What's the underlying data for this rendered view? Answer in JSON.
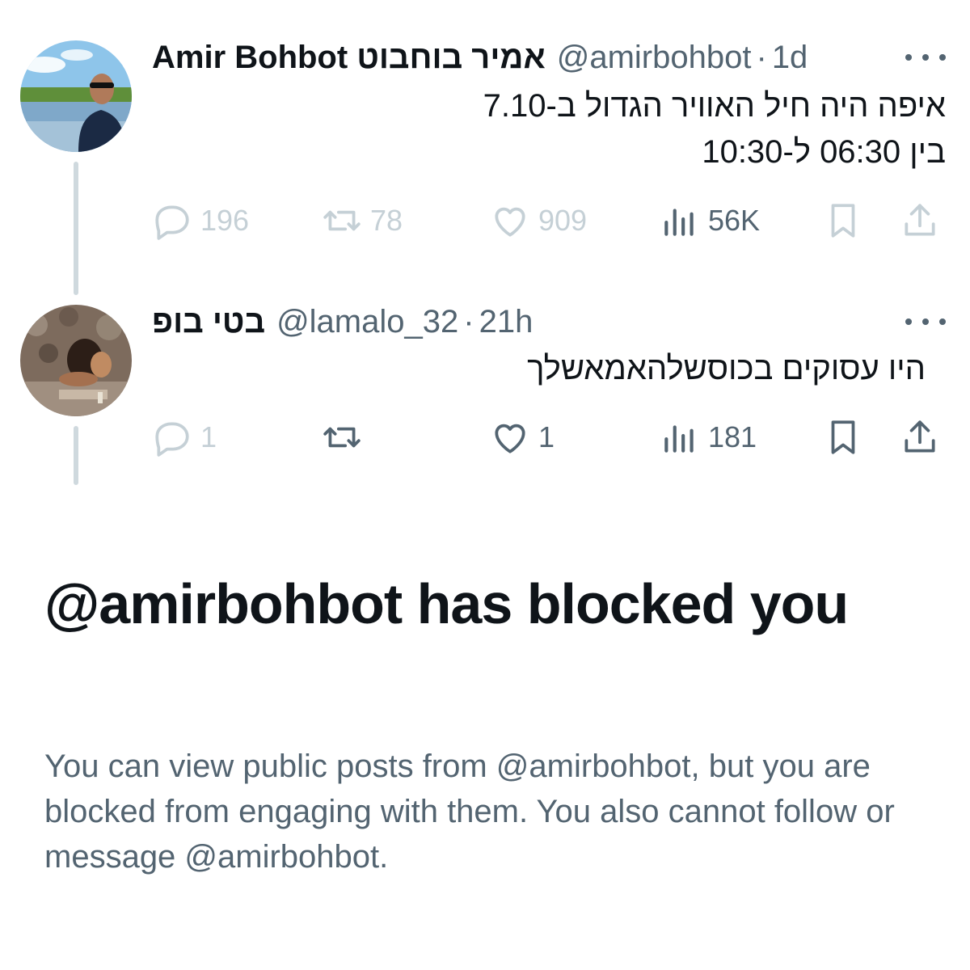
{
  "tweets": [
    {
      "name": "Amir Bohbot אמיר בוחבוט",
      "handle": "@amirbohbot",
      "time": "1d",
      "text_lines": [
        "איפה היה חיל האוויר הגדול ב-7.10",
        "בין 06:30 ל-10:30"
      ],
      "stats": {
        "replies": "196",
        "reposts": "78",
        "likes": "909",
        "views": "56K"
      },
      "icons": [
        "reply-icon",
        "repost-icon",
        "like-icon",
        "views-icon",
        "bookmark-icon",
        "share-icon"
      ]
    },
    {
      "name": "בטי בופ",
      "handle": "@lamalo_32",
      "time": "21h",
      "text": "היו עסוקים בכוסשלהאמאשלך",
      "stats": {
        "replies": "1",
        "reposts": "",
        "likes": "1",
        "views": "181"
      },
      "icons": [
        "reply-icon",
        "repost-icon",
        "like-icon",
        "views-icon",
        "bookmark-icon",
        "share-icon"
      ]
    }
  ],
  "blocked": {
    "title": "@amirbohbot has blocked you",
    "description": "You can view public posts from @amirbohbot, but you are blocked from engaging with them. You also cannot follow or message @amirbohbot."
  },
  "colors": {
    "primary_text": "#0f1419",
    "secondary_text": "#536471",
    "faded_icon": "#c5d0d6",
    "thread_line": "#cfd9de"
  }
}
